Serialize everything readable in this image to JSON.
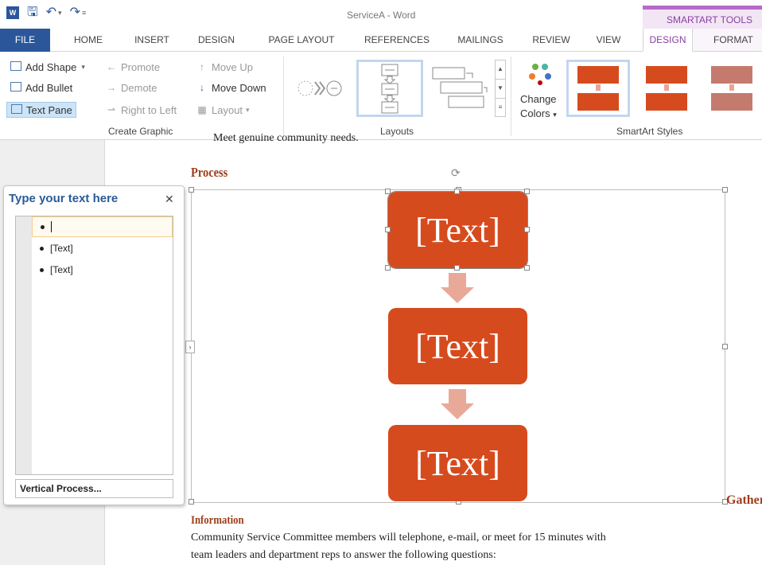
{
  "window": {
    "title": "ServiceA - Word",
    "contextual_group": "SMARTART TOOLS"
  },
  "qat": {
    "save_icon": "save-icon",
    "undo_icon": "undo-icon",
    "redo_icon": "redo-icon"
  },
  "tabs": [
    "FILE",
    "HOME",
    "INSERT",
    "DESIGN",
    "PAGE LAYOUT",
    "REFERENCES",
    "MAILINGS",
    "REVIEW",
    "VIEW",
    "DESIGN",
    "FORMAT"
  ],
  "ribbon": {
    "create_graphic": {
      "label": "Create Graphic",
      "add_shape": "Add Shape",
      "add_bullet": "Add Bullet",
      "text_pane": "Text Pane",
      "promote": "Promote",
      "demote": "Demote",
      "right_to_left": "Right to Left",
      "move_up": "Move Up",
      "move_down": "Move Down",
      "layout": "Layout"
    },
    "layouts": {
      "label": "Layouts"
    },
    "styles": {
      "label": "SmartArt Styles",
      "change_colors_1": "Change",
      "change_colors_2": "Colors"
    }
  },
  "document": {
    "cut_line": "Meet genuine community needs.",
    "process_heading": "Process",
    "gather_cut": "Gather",
    "info_heading": "Information",
    "body_line_1": "Community Service Committee members will telephone, e-mail, or meet for 15 minutes with",
    "body_line_2": "team leaders and department reps to answer the following questions:"
  },
  "text_pane": {
    "title": "Type your text here",
    "items": [
      "",
      "[Text]",
      "[Text]"
    ],
    "footer": "Vertical Process..."
  },
  "smartart": {
    "boxes": [
      "[Text]",
      "[Text]",
      "[Text]"
    ],
    "box_color": "#d64b1e",
    "arrow_color": "#e9a998"
  },
  "colors": {
    "word_blue": "#2b579a",
    "smartart_purple": "#8a3fa3",
    "heading_brown": "#9c3c1a"
  }
}
